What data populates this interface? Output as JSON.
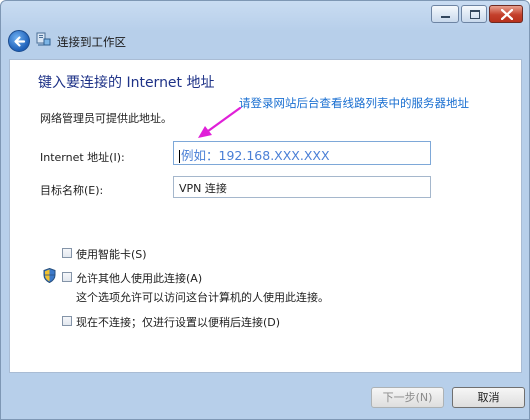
{
  "window": {
    "nav_title": "连接到工作区"
  },
  "page": {
    "heading": "键入要连接的 Internet 地址",
    "annotation": "请登录网站后台查看线路列表中的服务器地址",
    "admin_note": "网络管理员可提供此地址。"
  },
  "form": {
    "address_label": "Internet 地址(I):",
    "address_value": "例如：192.168.XXX.XXX",
    "destination_label": "目标名称(E):",
    "destination_value": "VPN 连接"
  },
  "options": {
    "smart_card": {
      "label": "使用智能卡(S)",
      "checked": false
    },
    "allow_others": {
      "label": "允许其他人使用此连接(A)",
      "checked": false,
      "description": "这个选项允许可以访问这台计算机的人使用此连接。"
    },
    "connect_later": {
      "label": "现在不连接；仅进行设置以便稍后连接(D)",
      "checked": false
    }
  },
  "buttons": {
    "next": "下一步(N)",
    "cancel": "取消"
  },
  "icons": {
    "back": "back-arrow-icon",
    "network": "network-icon",
    "uac": "uac-shield-icon",
    "pointer_arrow": "pointer-arrow-icon"
  },
  "colors": {
    "heading": "#1e3287",
    "annotation": "#1a6fd1",
    "pointer_arrow": "#e020d8"
  }
}
